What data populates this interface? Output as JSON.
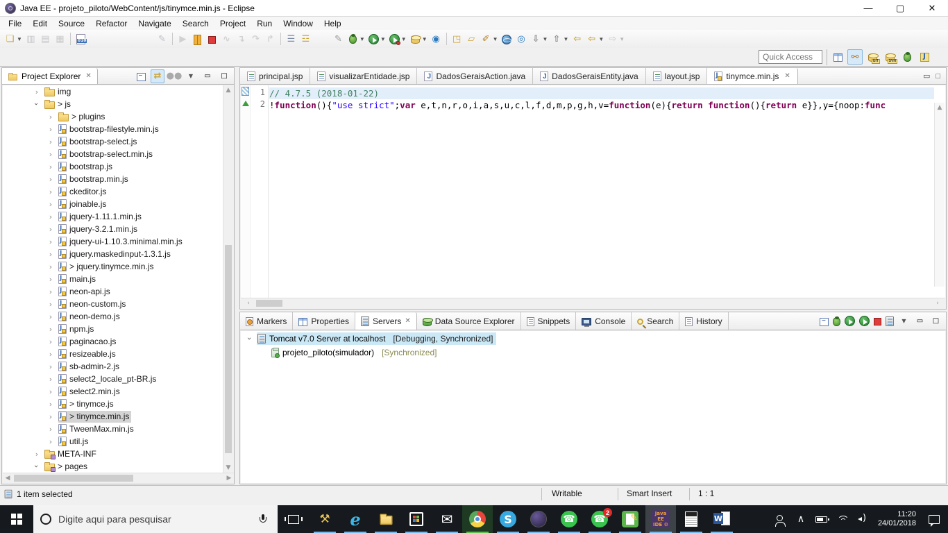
{
  "window": {
    "title": "Java EE - projeto_piloto/WebContent/js/tinymce.min.js - Eclipse"
  },
  "menu": [
    "File",
    "Edit",
    "Source",
    "Refactor",
    "Navigate",
    "Search",
    "Project",
    "Run",
    "Window",
    "Help"
  ],
  "toolbar": [
    {
      "name": "new-wizard",
      "glyph": "new",
      "dropdown": true
    },
    {
      "name": "save",
      "glyph": "save",
      "disabled": true
    },
    {
      "name": "save-all",
      "glyph": "save-all",
      "disabled": true
    },
    {
      "name": "print",
      "glyph": "print",
      "disabled": true
    },
    {
      "name": "sep"
    },
    {
      "name": "binary-file",
      "glyph": "binary"
    },
    {
      "name": "gap"
    },
    {
      "name": "mark-occurrences",
      "glyph": "pen-slash",
      "disabled": true
    },
    {
      "name": "sep"
    },
    {
      "name": "resume",
      "glyph": "resume",
      "disabled": true
    },
    {
      "name": "suspend",
      "glyph": "pause"
    },
    {
      "name": "terminate",
      "glyph": "stop"
    },
    {
      "name": "disconnect",
      "glyph": "disconnect",
      "disabled": true
    },
    {
      "name": "step-into",
      "glyph": "step-into",
      "disabled": true
    },
    {
      "name": "step-over",
      "glyph": "step-over",
      "disabled": true
    },
    {
      "name": "step-return",
      "glyph": "step-return",
      "disabled": true
    },
    {
      "name": "sep"
    },
    {
      "name": "skip-all-breakpoints",
      "glyph": "skip"
    },
    {
      "name": "use-step-filters",
      "glyph": "filters"
    },
    {
      "name": "gap-sm"
    },
    {
      "name": "java-editor-pen",
      "glyph": "pen"
    },
    {
      "name": "debug",
      "glyph": "bug",
      "dropdown": true
    },
    {
      "name": "run",
      "glyph": "play",
      "dropdown": true
    },
    {
      "name": "coverage",
      "glyph": "play-red",
      "dropdown": true
    },
    {
      "name": "new-artifact",
      "glyph": "db-new",
      "dropdown": true
    },
    {
      "name": "web-service",
      "glyph": "globe-s"
    },
    {
      "name": "sep"
    },
    {
      "name": "open-web-folder",
      "glyph": "folder-globe"
    },
    {
      "name": "open-folder",
      "glyph": "folder-open"
    },
    {
      "name": "format-brush",
      "glyph": "brush",
      "dropdown": true
    },
    {
      "name": "open-browser",
      "glyph": "globe"
    },
    {
      "name": "synchronize-web",
      "glyph": "globe-arrow"
    },
    {
      "name": "next-annotation",
      "glyph": "file-next",
      "dropdown": true
    },
    {
      "name": "previous-annotation",
      "glyph": "file-prev",
      "dropdown": true
    },
    {
      "name": "last-edit-location",
      "glyph": "back-edit"
    },
    {
      "name": "back-history",
      "glyph": "back",
      "dropdown": true
    },
    {
      "name": "forward-history",
      "glyph": "forward",
      "dropdown": true,
      "disabled": true
    }
  ],
  "quick_access": {
    "label": "Quick Access"
  },
  "perspectives": [
    {
      "name": "open-perspective",
      "label": ""
    },
    {
      "name": "java-ee",
      "label": "",
      "active": true
    },
    {
      "name": "git",
      "label": "GIT"
    },
    {
      "name": "svn",
      "label": "SVN"
    },
    {
      "name": "debug",
      "label": ""
    },
    {
      "name": "java",
      "label": ""
    }
  ],
  "project_explorer": {
    "title": "Project Explorer",
    "toolbar": [
      "collapse-all",
      "link-with-editor",
      "focus-active-task",
      "view-menu",
      "minimize",
      "maximize"
    ],
    "tree": [
      {
        "label": "img",
        "level": 0,
        "icon": "folder",
        "chevron": "collapsed"
      },
      {
        "label": "js",
        "level": 0,
        "icon": "folder",
        "chevron": "expanded",
        "dirty": true
      },
      {
        "label": "plugins",
        "level": 1,
        "icon": "folder",
        "chevron": "collapsed",
        "dirty": true
      },
      {
        "label": "bootstrap-filestyle.min.js",
        "level": 1,
        "icon": "jsfile",
        "chevron": "collapsed"
      },
      {
        "label": "bootstrap-select.js",
        "level": 1,
        "icon": "jsfile",
        "chevron": "collapsed"
      },
      {
        "label": "bootstrap-select.min.js",
        "level": 1,
        "icon": "jsfile",
        "chevron": "collapsed"
      },
      {
        "label": "bootstrap.js",
        "level": 1,
        "icon": "jsfile",
        "chevron": "collapsed"
      },
      {
        "label": "bootstrap.min.js",
        "level": 1,
        "icon": "jsfile",
        "chevron": "collapsed"
      },
      {
        "label": "ckeditor.js",
        "level": 1,
        "icon": "jsfile",
        "chevron": "collapsed"
      },
      {
        "label": "joinable.js",
        "level": 1,
        "icon": "jsfile",
        "chevron": "collapsed"
      },
      {
        "label": "jquery-1.11.1.min.js",
        "level": 1,
        "icon": "jsfile",
        "chevron": "collapsed"
      },
      {
        "label": "jquery-3.2.1.min.js",
        "level": 1,
        "icon": "jsfile",
        "chevron": "collapsed"
      },
      {
        "label": "jquery-ui-1.10.3.minimal.min.js",
        "level": 1,
        "icon": "jsfile",
        "chevron": "collapsed"
      },
      {
        "label": "jquery.maskedinput-1.3.1.js",
        "level": 1,
        "icon": "jsfile",
        "chevron": "collapsed"
      },
      {
        "label": "jquery.tinymce.min.js",
        "level": 1,
        "icon": "jsfile",
        "chevron": "collapsed",
        "dirty": true
      },
      {
        "label": "main.js",
        "level": 1,
        "icon": "jsfile",
        "chevron": "collapsed"
      },
      {
        "label": "neon-api.js",
        "level": 1,
        "icon": "jsfile",
        "chevron": "collapsed"
      },
      {
        "label": "neon-custom.js",
        "level": 1,
        "icon": "jsfile",
        "chevron": "collapsed"
      },
      {
        "label": "neon-demo.js",
        "level": 1,
        "icon": "jsfile",
        "chevron": "collapsed"
      },
      {
        "label": "npm.js",
        "level": 1,
        "icon": "jsfile",
        "chevron": "collapsed"
      },
      {
        "label": "paginacao.js",
        "level": 1,
        "icon": "jsfile",
        "chevron": "collapsed"
      },
      {
        "label": "resizeable.js",
        "level": 1,
        "icon": "jsfile",
        "chevron": "collapsed"
      },
      {
        "label": "sb-admin-2.js",
        "level": 1,
        "icon": "jsfile",
        "chevron": "collapsed"
      },
      {
        "label": "select2_locale_pt-BR.js",
        "level": 1,
        "icon": "jsfile",
        "chevron": "collapsed"
      },
      {
        "label": "select2.min.js",
        "level": 1,
        "icon": "jsfile",
        "chevron": "collapsed"
      },
      {
        "label": "tinymce.js",
        "level": 1,
        "icon": "jsfile",
        "chevron": "collapsed",
        "dirty": true
      },
      {
        "label": "tinymce.min.js",
        "level": 1,
        "icon": "jsfile",
        "chevron": "collapsed",
        "dirty": true,
        "selected": true
      },
      {
        "label": "TweenMax.min.js",
        "level": 1,
        "icon": "jsfile",
        "chevron": "collapsed"
      },
      {
        "label": "util.js",
        "level": 1,
        "icon": "jsfile",
        "chevron": "collapsed"
      },
      {
        "label": "META-INF",
        "level": 0,
        "icon": "folder-meta",
        "chevron": "collapsed"
      },
      {
        "label": "pages",
        "level": 0,
        "icon": "folder-meta",
        "chevron": "expanded",
        "dirty": true
      }
    ]
  },
  "editor": {
    "tabs": [
      {
        "label": "principal.jsp",
        "icon": "jsp"
      },
      {
        "label": "visualizarEntidade.jsp",
        "icon": "jsp"
      },
      {
        "label": "DadosGeraisAction.java",
        "icon": "java"
      },
      {
        "label": "DadosGeraisEntity.java",
        "icon": "java"
      },
      {
        "label": "layout.jsp",
        "icon": "jsp"
      },
      {
        "label": "tinymce.min.js",
        "icon": "js",
        "active": true,
        "closable": true
      }
    ],
    "lines": [
      {
        "number": "1",
        "highlight": true,
        "tokens": [
          {
            "text": "// 4.7.5 (2018-01-22)",
            "style": "comment"
          }
        ]
      },
      {
        "number": "2",
        "highlight": false,
        "tokens": [
          {
            "text": "!",
            "style": "plain"
          },
          {
            "text": "function",
            "style": "kw"
          },
          {
            "text": "(){",
            "style": "plain"
          },
          {
            "text": "\"use strict\"",
            "style": "str"
          },
          {
            "text": ";",
            "style": "plain"
          },
          {
            "text": "var",
            "style": "kw"
          },
          {
            "text": " e,t,n,r,o,i,a,s,u,c,l,f,d,m,p,g,h,v=",
            "style": "plain"
          },
          {
            "text": "function",
            "style": "kw"
          },
          {
            "text": "(e){",
            "style": "plain"
          },
          {
            "text": "return",
            "style": "kw"
          },
          {
            "text": " ",
            "style": "plain"
          },
          {
            "text": "function",
            "style": "kw"
          },
          {
            "text": "(){",
            "style": "plain"
          },
          {
            "text": "return",
            "style": "kw"
          },
          {
            "text": " e}},y={noop:",
            "style": "plain"
          },
          {
            "text": "func",
            "style": "kw"
          }
        ]
      }
    ]
  },
  "bottom_panel": {
    "tabs": [
      {
        "label": "Markers",
        "icon": "markers"
      },
      {
        "label": "Properties",
        "icon": "properties"
      },
      {
        "label": "Servers",
        "icon": "servers",
        "active": true,
        "closable": true
      },
      {
        "label": "Data Source Explorer",
        "icon": "datasource"
      },
      {
        "label": "Snippets",
        "icon": "snippets"
      },
      {
        "label": "Console",
        "icon": "console"
      },
      {
        "label": "Search",
        "icon": "search"
      },
      {
        "label": "History",
        "icon": "history"
      }
    ],
    "toolbar": [
      "collapse-all",
      "debug",
      "start",
      "profile",
      "stop",
      "publish",
      "view-menu",
      "minimize",
      "maximize"
    ],
    "servers": [
      {
        "label": "Tomcat v7.0 Server at localhost",
        "state": "[Debugging, Synchronized]",
        "icon": "server",
        "chevron": "expanded",
        "level": 0,
        "selected": true,
        "state_style": "plain"
      },
      {
        "label": "projeto_piloto(simulador)",
        "state": "[Synchronized]",
        "icon": "module",
        "level": 1,
        "selected": false,
        "state_style": "olive"
      }
    ]
  },
  "status_bar": {
    "left": "1 item selected",
    "writable": "Writable",
    "insert_mode": "Smart Insert",
    "caret": "1 : 1"
  },
  "taskbar": {
    "search_placeholder": "Digite aqui para pesquisar",
    "apps": [
      {
        "name": "dev-tool"
      },
      {
        "name": "edge"
      },
      {
        "name": "file-explorer"
      },
      {
        "name": "store"
      },
      {
        "name": "mail"
      },
      {
        "name": "chrome",
        "highlight": true
      },
      {
        "name": "skype"
      },
      {
        "name": "eclipse"
      },
      {
        "name": "whatsapp"
      },
      {
        "name": "whatsapp-alt",
        "badge": "2"
      },
      {
        "name": "notepad"
      },
      {
        "name": "java-ee-ide",
        "active": true
      },
      {
        "name": "calculator"
      },
      {
        "name": "word"
      }
    ],
    "tray": {
      "time": "11:20",
      "date": "24/01/2018"
    }
  },
  "colors": {
    "keyword": "#7f0055",
    "string": "#2a00ff",
    "comment": "#3f7f5f",
    "tree_selection": "#d4d4d4",
    "server_selection": "#cbe8f6",
    "state_olive": "#8a8a52",
    "taskbar": "#161a1e"
  }
}
